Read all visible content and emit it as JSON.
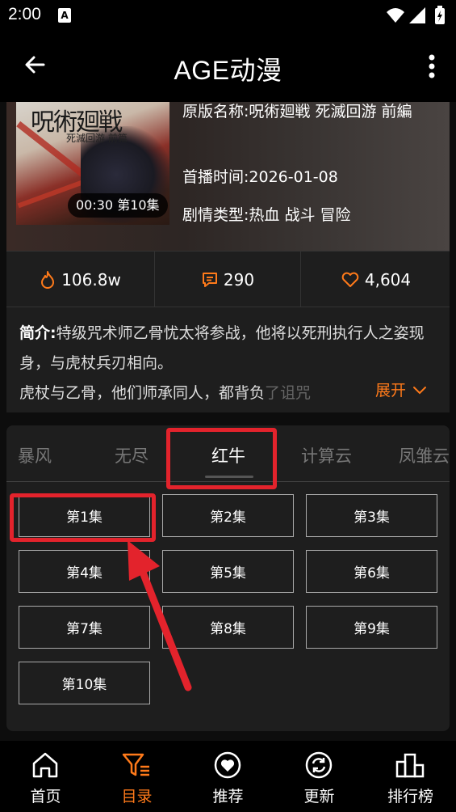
{
  "status_bar": {
    "time": "2:00",
    "notification": "A"
  },
  "app_bar": {
    "title": "AGE动漫"
  },
  "hero": {
    "poster_title_art": "呪術廻戦",
    "poster_subtitle_art": "死滅回游 前篇",
    "episode_badge": "00:30 第10集",
    "original_name_label": "原版名称:",
    "original_name_value": "呪術廻戦 死滅回游 前編",
    "premiere_label": "首播时间:",
    "premiere_value": "2026-01-08",
    "genre_label": "剧情类型:",
    "genre_value": "热血 战斗 冒险"
  },
  "stats": {
    "views": "106.8w",
    "comments": "290",
    "likes": "4,604"
  },
  "intro": {
    "label": "简介:",
    "line1": "特级咒术师乙骨忧太将参战，他将以死刑执行人之姿现身，与虎杖兵刃相向。",
    "line2": "虎杖与乙骨，他们师承同人，都背负",
    "line2_fade": "了诅咒",
    "expand_label": "展开"
  },
  "source_tabs": [
    {
      "label": "暴风"
    },
    {
      "label": "无尽"
    },
    {
      "label": "红牛",
      "active": true
    },
    {
      "label": "计算云"
    },
    {
      "label": "凤雏云"
    }
  ],
  "episodes": [
    "第1集",
    "第2集",
    "第3集",
    "第4集",
    "第5集",
    "第6集",
    "第7集",
    "第8集",
    "第9集",
    "第10集"
  ],
  "nav": [
    {
      "label": "首页",
      "icon": "home-icon"
    },
    {
      "label": "目录",
      "icon": "filter-list-icon",
      "active": true
    },
    {
      "label": "推荐",
      "icon": "heart-circle-icon"
    },
    {
      "label": "更新",
      "icon": "refresh-circle-icon"
    },
    {
      "label": "排行榜",
      "icon": "podium-icon"
    }
  ],
  "colors": {
    "accent": "#ff7a1a",
    "annotation": "#e3232c",
    "panel": "#1e1e1e"
  }
}
